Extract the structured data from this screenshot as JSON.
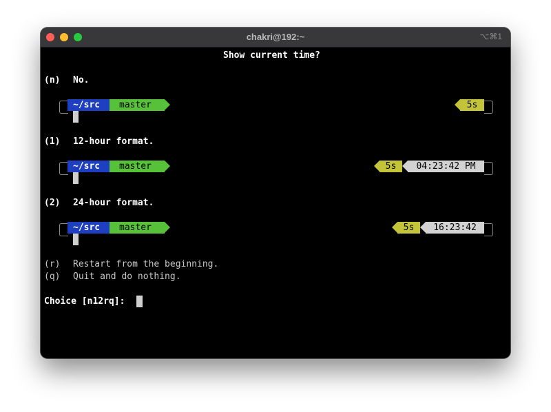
{
  "window": {
    "title": "chakri@192:~",
    "shortcut": "⌥⌘1"
  },
  "terminal": {
    "heading": "Show current time?",
    "options": [
      {
        "key": "(n)",
        "label": "No.",
        "prompt": {
          "dir": "~/src",
          "branch": "master",
          "duration": "5s",
          "time": ""
        }
      },
      {
        "key": "(1)",
        "label": "12-hour format.",
        "prompt": {
          "dir": "~/src",
          "branch": "master",
          "duration": "5s",
          "time": "04:23:42 PM"
        }
      },
      {
        "key": "(2)",
        "label": "24-hour format.",
        "prompt": {
          "dir": "~/src",
          "branch": "master",
          "duration": "5s",
          "time": "16:23:42"
        }
      }
    ],
    "restart": {
      "key": "(r)",
      "label": "Restart from the beginning."
    },
    "quit": {
      "key": "(q)",
      "label": "Quit and do nothing."
    },
    "choice_prompt": "Choice [n12rq]:"
  },
  "colors": {
    "dir_segment": "#1d3fc0",
    "branch_segment": "#58c13a",
    "duration_segment": "#c4c43a",
    "time_segment": "#d2d2d2"
  }
}
